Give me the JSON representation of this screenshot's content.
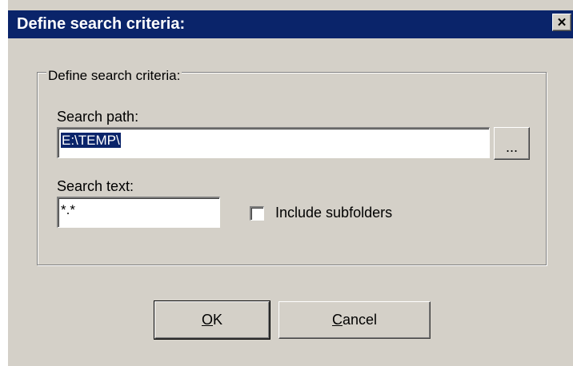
{
  "window": {
    "title": "Define search criteria:",
    "close_glyph": "✕",
    "close_icon": "close-icon"
  },
  "group": {
    "label": "Define search criteria:"
  },
  "search_path": {
    "label": "Search path:",
    "value": "E:\\TEMP\\",
    "browse_label": "..."
  },
  "search_text": {
    "label": "Search text:",
    "value": "*.*"
  },
  "include_subfolders": {
    "label": "Include subfolders",
    "checked": false
  },
  "buttons": {
    "ok_mnemonic": "O",
    "ok_rest": "K",
    "cancel_mnemonic": "C",
    "cancel_rest": "ancel"
  },
  "colors": {
    "titlebar": "#0a246a",
    "face": "#d4d0c8",
    "selection": "#0a246a"
  }
}
